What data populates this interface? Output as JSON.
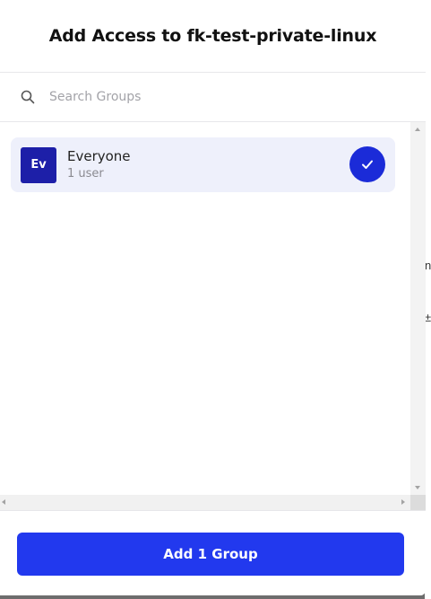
{
  "modal": {
    "title": "Add Access to fk-test-private-linux"
  },
  "search": {
    "placeholder": "Search Groups",
    "value": "",
    "icon": "search-icon"
  },
  "groups": [
    {
      "avatar_text": "Ev",
      "name": "Everyone",
      "meta": "1 user",
      "selected": true,
      "icon": "check-icon"
    }
  ],
  "footer": {
    "primary_label": "Add 1 Group"
  },
  "colors": {
    "accent": "#2239ee",
    "avatar_bg": "#1d1fa8",
    "selected_row_bg": "#eef0fb",
    "check_bg": "#1b2bd8"
  }
}
